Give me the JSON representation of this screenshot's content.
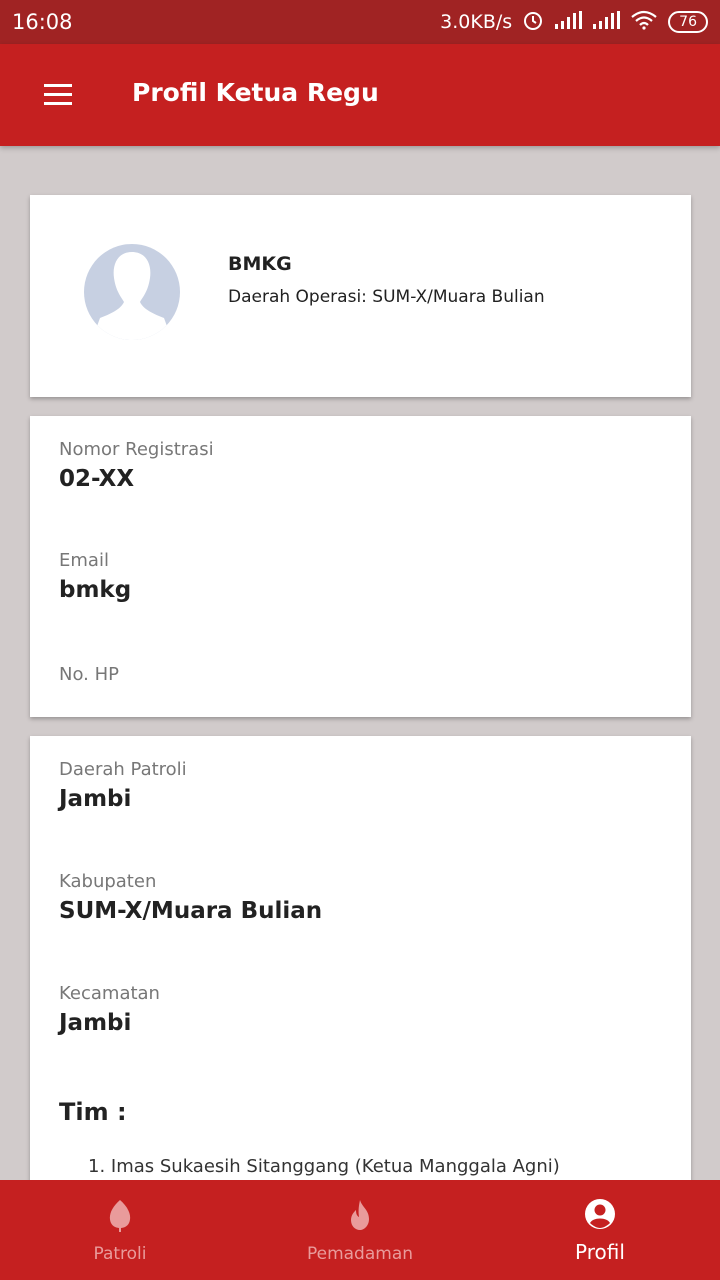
{
  "status_bar": {
    "time": "16:08",
    "network_speed": "3.0KB/s",
    "battery": "76",
    "icons": [
      "alarm-icon",
      "signal-icon",
      "signal-icon",
      "wifi-icon",
      "battery-icon"
    ]
  },
  "app_bar": {
    "title": "Profil Ketua Regu",
    "menu_icon": "menu-icon"
  },
  "profile": {
    "name": "BMKG",
    "area": "Daerah Operasi: SUM-X/Muara Bulian",
    "avatar_icon": "person-silhouette"
  },
  "account": {
    "reg_label": "Nomor Registrasi",
    "reg_value": "02-XX",
    "email_label": "Email",
    "email_value": "bmkg",
    "phone_label": "No. HP",
    "phone_value": ""
  },
  "patrol": {
    "area_label": "Daerah Patroli",
    "area_value": "Jambi",
    "kab_label": "Kabupaten",
    "kab_value": "SUM-X/Muara Bulian",
    "kec_label": "Kecamatan",
    "kec_value": "Jambi",
    "team_heading": "Tim :",
    "team": [
      "1. Imas Sukaesih Sitanggang (Ketua Manggala Agni)"
    ]
  },
  "bottom_nav": {
    "items": [
      {
        "label": "Patroli",
        "icon": "leaf-icon",
        "active": false
      },
      {
        "label": "Pemadaman",
        "icon": "fire-icon",
        "active": false
      },
      {
        "label": "Profil",
        "icon": "account-circle-icon",
        "active": true
      }
    ]
  },
  "colors": {
    "primary": "#c52020",
    "status_bar": "#a02323",
    "background": "#d1cbcb",
    "nav_inactive": "#e99b9b"
  }
}
